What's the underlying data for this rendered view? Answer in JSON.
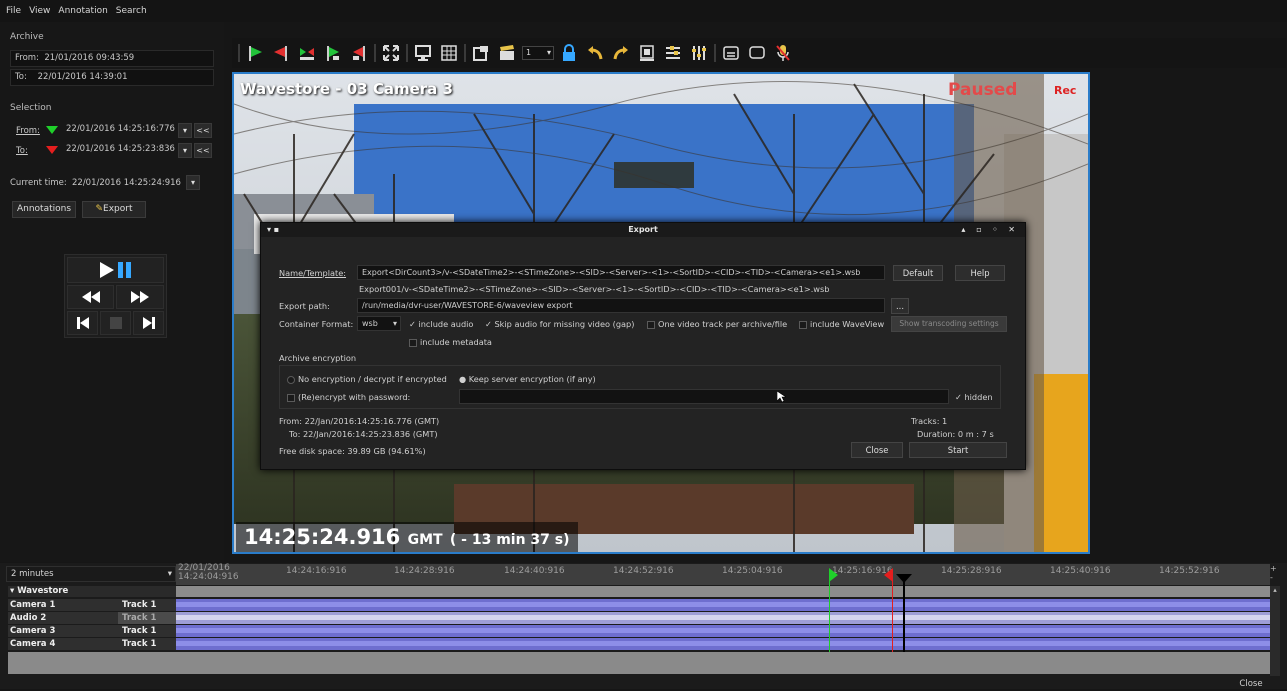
{
  "menu": [
    "File",
    "View",
    "Annotation",
    "Search"
  ],
  "archive": {
    "title": "Archive",
    "from_label": "From:",
    "from_value": "21/01/2016 09:43:59",
    "to_label": "To:",
    "to_value": "22/01/2016 14:39:01"
  },
  "selection": {
    "title": "Selection",
    "from_label": "From:",
    "from_value": "22/01/2016 14:25:16:776",
    "to_label": "To:",
    "to_value": "22/01/2016 14:25:23:836",
    "rewind_label": "<<"
  },
  "current_time": {
    "label": "Current time:",
    "value": "22/01/2016 14:25:24:916"
  },
  "buttons": {
    "annotations": "Annotations",
    "export": "Export"
  },
  "toolbar": {
    "speed_value": "1"
  },
  "video": {
    "title": "Wavestore - 03 Camera 3",
    "status": "Paused",
    "rec": "Rec",
    "timestamp": "14:25:24.916",
    "timezone": "GMT",
    "offset": "( - 13 min 37 s)"
  },
  "export_dialog": {
    "title": "Export",
    "name_label": "Name/Template:",
    "name_value": "Export<DirCount3>/v-<SDateTime2>-<STimeZone>-<SID>-<Server>-<1>-<SortID>-<CID>-<TID>-<Camera><e1>.wsb",
    "name_preview": "Export001/v-<SDateTime2>-<STimeZone>-<SID>-<Server>-<1>-<SortID>-<CID>-<TID>-<Camera><e1>.wsb",
    "default_btn": "Default",
    "help_btn": "Help",
    "path_label": "Export path:",
    "path_value": "/run/media/dvr-user/WAVESTORE-6/waveview export",
    "browse_btn": "...",
    "format_label": "Container Format:",
    "format_value": "wsb",
    "include_audio": "include audio",
    "skip_audio": "Skip audio for missing video (gap)",
    "one_video_track": "One video track per archive/file",
    "include_waveview": "include WaveView",
    "transcoding_btn": "Show transcoding settings",
    "include_metadata": "include metadata",
    "encryption_title": "Archive encryption",
    "no_encryption": "No encryption / decrypt if encrypted",
    "keep_encryption": "Keep server encryption (if any)",
    "reencrypt": "(Re)encrypt with password:",
    "hidden": "hidden",
    "from_summary": "From: 22/Jan/2016:14:25:16.776 (GMT)",
    "to_summary": "To: 22/Jan/2016:14:25:23.836 (GMT)",
    "tracks": "Tracks: 1",
    "duration": "Duration: 0 m : 7 s",
    "disk_space": "Free disk space: 39.89 GB (94.61%)",
    "close_btn": "Close",
    "start_btn": "Start"
  },
  "timeline": {
    "zoom": "2 minutes",
    "ticks": [
      "22/01/2016 14:24:04:916",
      "14:24:16:916",
      "14:24:28:916",
      "14:24:40:916",
      "14:24:52:916",
      "14:25:04:916",
      "14:25:16:916",
      "14:25:28:916",
      "14:25:40:916",
      "14:25:52:916"
    ],
    "group": "Wavestore",
    "rows": [
      {
        "name": "Camera 1",
        "track": "Track 1"
      },
      {
        "name": "Audio 2",
        "track": "Track 1"
      },
      {
        "name": "Camera 3",
        "track": "Track 1"
      },
      {
        "name": "Camera 4",
        "track": "Track 1"
      }
    ],
    "close_label": "Close"
  }
}
